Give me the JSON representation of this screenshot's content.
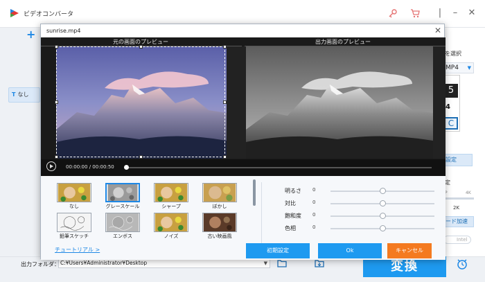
{
  "app": {
    "title": "ビデオコンバータ",
    "sidebar_none_label": "なし",
    "right_labels": {
      "format_select": "を選択",
      "format_value": "MP4",
      "card_digit": "5",
      "card_small": "4",
      "card_c": "C",
      "settings": "設定",
      "quality": "定",
      "quality_hi": "4K",
      "quality_lo": "P",
      "quality_mark": "2K",
      "hw_accel": "ード加速",
      "intel": "Intel"
    },
    "output_folder_label": "出力フォルダ：",
    "output_folder_path": "C:¥Users¥Administrator¥Desktop",
    "convert_label": "変換"
  },
  "modal": {
    "title": "sunrise.mp4",
    "source_preview_label": "元の画面のプレビュー",
    "output_preview_label": "出力画面のプレビュー",
    "current_time": "00:00:00",
    "time_separator": "/",
    "duration": "00:00:50",
    "progress": 0.0,
    "effects": [
      {
        "label": "なし",
        "style": "color",
        "selected": false
      },
      {
        "label": "グレースケール",
        "style": "gray",
        "selected": true
      },
      {
        "label": "シャープ",
        "style": "color",
        "selected": false
      },
      {
        "label": "ぼかし",
        "style": "blur",
        "selected": false
      },
      {
        "label": "鉛筆スケッチ",
        "style": "sketch",
        "selected": false
      },
      {
        "label": "エンボス",
        "style": "emboss",
        "selected": false
      },
      {
        "label": "ノイズ",
        "style": "color",
        "selected": false
      },
      {
        "label": "古い映画風",
        "style": "sepia",
        "selected": false
      }
    ],
    "adjustments": [
      {
        "label": "明るさ",
        "value": "0",
        "level": 0.5
      },
      {
        "label": "対比",
        "value": "0",
        "level": 0.5
      },
      {
        "label": "飽和度",
        "value": "0",
        "level": 0.5
      },
      {
        "label": "色相",
        "value": "0",
        "level": 0.5
      }
    ],
    "tutorial_link": "チュートリアル >",
    "reset_label": "初期設定",
    "ok_label": "Ok",
    "cancel_label": "キャンセル"
  },
  "colors": {
    "accent_blue": "#1e9af0",
    "cancel_orange": "#f47a20"
  }
}
